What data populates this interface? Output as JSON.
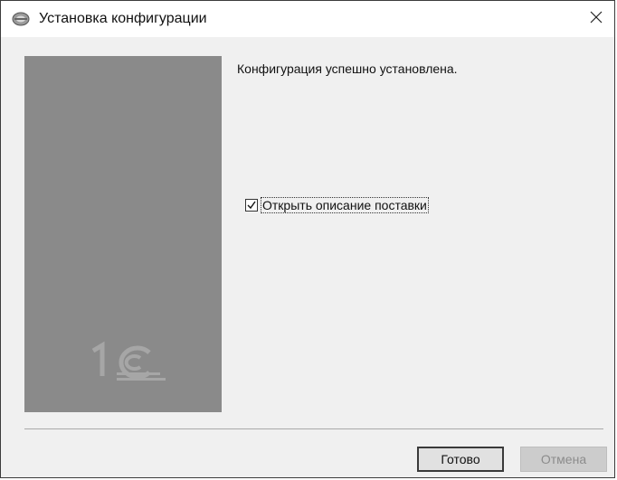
{
  "window": {
    "title": "Установка конфигурации",
    "close_glyph": "✕"
  },
  "main": {
    "message": "Конфигурация успешно установлена.",
    "open_description": {
      "label": "Открыть описание поставки",
      "checked": true
    }
  },
  "buttons": {
    "ok_label": "Готово",
    "cancel_label": "Отмена"
  },
  "logo": {
    "text": "1C"
  },
  "icons": {
    "app": "1c-app-icon",
    "close": "close-icon",
    "check": "checkmark-icon"
  }
}
